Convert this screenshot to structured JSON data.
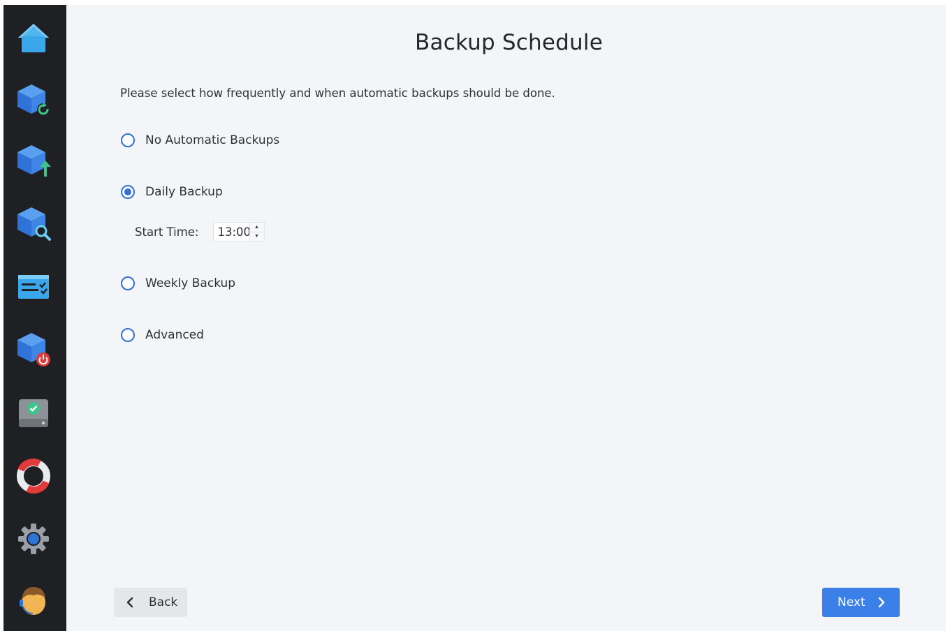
{
  "page": {
    "title": "Backup Schedule",
    "description": "Please select how frequently and when automatic backups should be done."
  },
  "sidebar": {
    "items": [
      {
        "name": "home-icon"
      },
      {
        "name": "backup-refresh-icon"
      },
      {
        "name": "backup-upload-icon"
      },
      {
        "name": "backup-search-icon"
      },
      {
        "name": "task-list-icon"
      },
      {
        "name": "backup-power-icon"
      },
      {
        "name": "drive-check-icon"
      },
      {
        "name": "lifebuoy-icon"
      },
      {
        "name": "gear-icon"
      },
      {
        "name": "support-avatar-icon"
      }
    ]
  },
  "schedule": {
    "options": [
      {
        "label": "No Automatic Backups",
        "checked": false
      },
      {
        "label": "Daily Backup",
        "checked": true
      },
      {
        "label": "Weekly Backup",
        "checked": false
      },
      {
        "label": "Advanced",
        "checked": false
      }
    ],
    "start_time_label": "Start Time:",
    "start_time_value": "13:00"
  },
  "footer": {
    "back_label": "Back",
    "next_label": "Next"
  },
  "colors": {
    "accent": "#3b80e8",
    "sidebar_bg": "#1f2023",
    "content_bg": "#f3f5f9"
  }
}
